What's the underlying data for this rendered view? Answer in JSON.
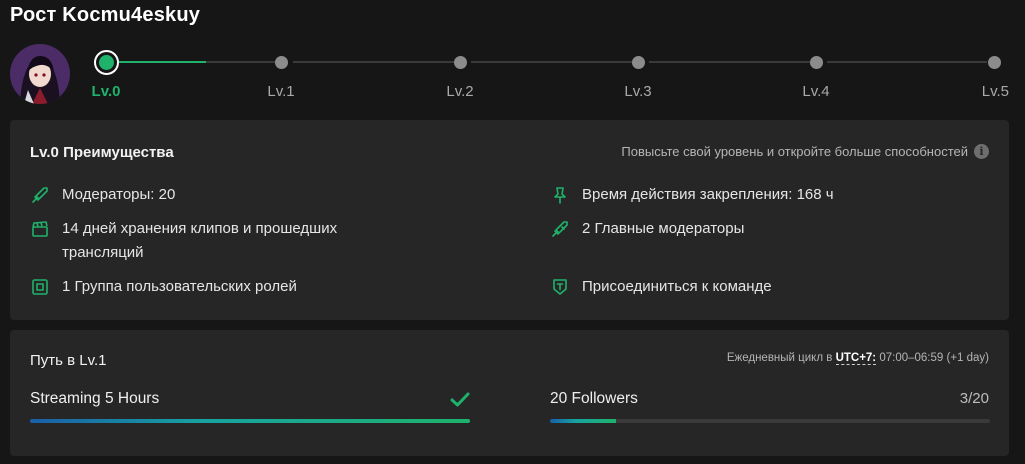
{
  "header": {
    "title": "Рост Kocmu4eskuy"
  },
  "levels": [
    {
      "label": "Lv.0",
      "current": true
    },
    {
      "label": "Lv.1",
      "current": false
    },
    {
      "label": "Lv.2",
      "current": false
    },
    {
      "label": "Lv.3",
      "current": false
    },
    {
      "label": "Lv.4",
      "current": false
    },
    {
      "label": "Lv.5",
      "current": false
    }
  ],
  "level_progress": 0.55,
  "benefits": {
    "title": "Lv.0 Преимущества",
    "hint": "Повысьте свой уровень и откройте больше способностей",
    "items": [
      {
        "icon": "sword-icon",
        "text": "Модераторы: 20"
      },
      {
        "icon": "clapperboard-icon",
        "text": "14 дней хранения клипов и прошедших трансляций"
      },
      {
        "icon": "role-group-icon",
        "text": "1 Группа пользовательских ролей"
      },
      {
        "icon": "pin-icon",
        "text": "Время действия закрепления: 168 ч"
      },
      {
        "icon": "moderator-sword-icon",
        "text": "2 Главные модераторы"
      },
      {
        "icon": "team-shield-icon",
        "text": "Присоединиться к команде"
      }
    ]
  },
  "path": {
    "title": "Путь в Lv.1",
    "cycle_prefix": "Ежедневный цикл в",
    "timezone": "UTC+7:",
    "cycle_time": "07:00–06:59 (+1 day)",
    "tasks": [
      {
        "label": "Streaming 5 Hours",
        "status": "done",
        "progress": 1.0
      },
      {
        "label": "20 Followers",
        "status": "3/20",
        "progress": 0.15
      }
    ]
  },
  "colors": {
    "accent": "#1fb26b",
    "panel": "#262626",
    "background": "#161616"
  }
}
